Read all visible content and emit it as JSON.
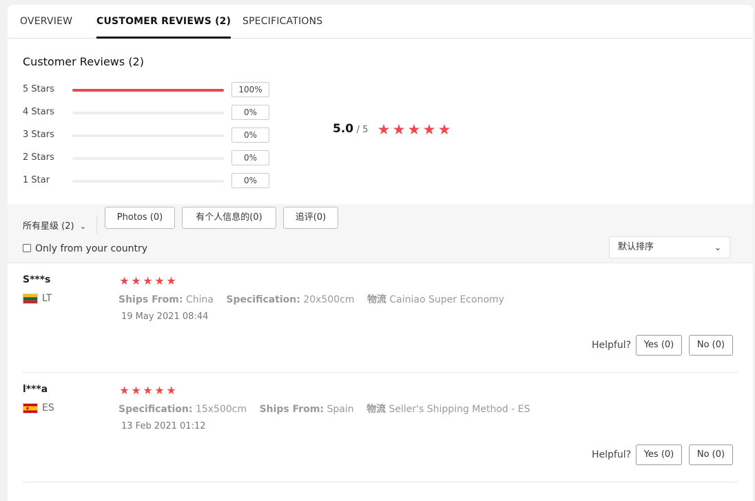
{
  "tabs": [
    {
      "label": "OVERVIEW"
    },
    {
      "label": "CUSTOMER REVIEWS (2)"
    },
    {
      "label": "SPECIFICATIONS"
    }
  ],
  "reviews_summary": {
    "title": "Customer Reviews (2)",
    "distribution": [
      {
        "label": "5 Stars",
        "percent": "100%",
        "fraction": 1.0
      },
      {
        "label": "4 Stars",
        "percent": "0%",
        "fraction": 0
      },
      {
        "label": "3 Stars",
        "percent": "0%",
        "fraction": 0
      },
      {
        "label": "2 Stars",
        "percent": "0%",
        "fraction": 0
      },
      {
        "label": "1 Star",
        "percent": "0%",
        "fraction": 0
      }
    ],
    "average": "5.0",
    "average_max": "/ 5",
    "average_stars": 5,
    "accent_color": "#f0484b"
  },
  "filters": {
    "rating_select": "所有星级 (2)",
    "buttons": [
      {
        "label": "Photos (0)"
      },
      {
        "label": "有个人信息的(0)"
      },
      {
        "label": "追评(0)"
      }
    ],
    "country_checkbox_label": "Only from your country",
    "country_checked": false,
    "sort_select": "默认排序"
  },
  "reviews": [
    {
      "user": "S***s",
      "country": "LT",
      "flag": "lithuania-flag",
      "stars": 5,
      "meta": [
        {
          "key": "Ships From:",
          "value": "China"
        },
        {
          "key": "Specification:",
          "value": "20x500cm"
        },
        {
          "key": "物流",
          "value": "Cainiao Super Economy"
        }
      ],
      "date": "19 May 2021 08:44",
      "helpful_label": "Helpful?",
      "yes_label": "Yes (0)",
      "no_label": "No (0)"
    },
    {
      "user": "l***a",
      "country": "ES",
      "flag": "spain-flag",
      "stars": 5,
      "meta": [
        {
          "key": "Specification:",
          "value": "15x500cm"
        },
        {
          "key": "Ships From:",
          "value": "Spain"
        },
        {
          "key": "物流",
          "value": "Seller's Shipping Method - ES"
        }
      ],
      "date": "13 Feb 2021 01:12",
      "helpful_label": "Helpful?",
      "yes_label": "Yes (0)",
      "no_label": "No (0)"
    }
  ]
}
